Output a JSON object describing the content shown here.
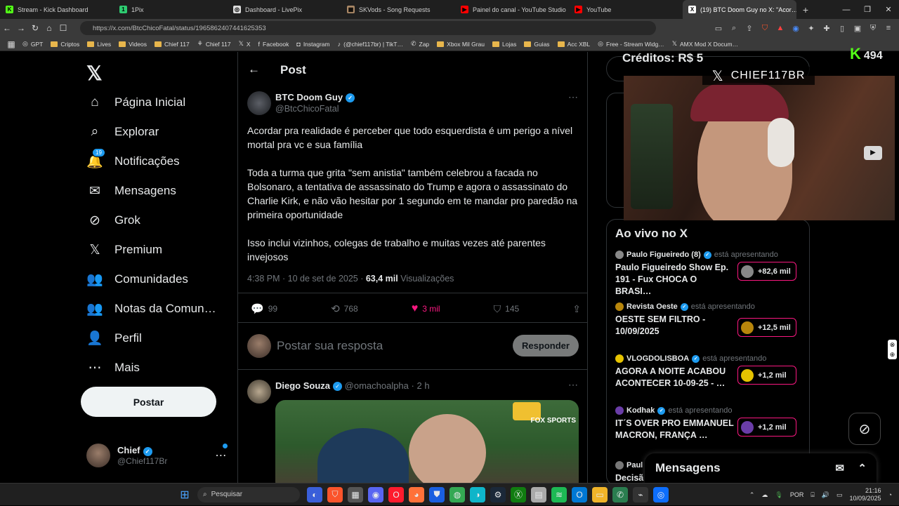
{
  "browser": {
    "tabs": [
      {
        "title": "Stream - Kick Dashboard",
        "color": "#53fc18",
        "glyph": "K"
      },
      {
        "title": "1Pix",
        "color": "#2ecc71",
        "glyph": "1"
      },
      {
        "title": "Dashboard - LivePix",
        "color": "#dddddd",
        "glyph": "◎"
      },
      {
        "title": "SKVods - Song Requests",
        "color": "#aa8866",
        "glyph": "▦"
      },
      {
        "title": "Painel do canal - YouTube Studio",
        "color": "#ff0000",
        "glyph": "▶"
      },
      {
        "title": "YouTube",
        "color": "#ff0000",
        "glyph": "▶"
      },
      {
        "title": "(19) BTC Doom Guy no X: \"Acor…",
        "color": "#ffffff",
        "glyph": "X",
        "active": true
      }
    ],
    "url": "https://x.com/BtcChicoFatal/status/1965862407441625353",
    "bookmarks": [
      {
        "label": "GPT",
        "icon": "◎"
      },
      {
        "label": "Criptos",
        "icon": "folder"
      },
      {
        "label": "Lives",
        "icon": "folder"
      },
      {
        "label": "Videos",
        "icon": "folder"
      },
      {
        "label": "Chief 117",
        "icon": "folder"
      },
      {
        "label": "Chief 117",
        "icon": "⚘"
      },
      {
        "label": "X",
        "icon": "𝕏"
      },
      {
        "label": "Facebook",
        "icon": "f"
      },
      {
        "label": "Instagram",
        "icon": "◘"
      },
      {
        "label": "(@chief117br) | TikT…",
        "icon": "♪"
      },
      {
        "label": "Zap",
        "icon": "✆"
      },
      {
        "label": "Xbox Mil Grau",
        "icon": "folder"
      },
      {
        "label": "Lojas",
        "icon": "folder"
      },
      {
        "label": "Guias",
        "icon": "folder"
      },
      {
        "label": "Acc XBL",
        "icon": "folder"
      },
      {
        "label": "Free - Stream Widg…",
        "icon": "◎"
      },
      {
        "label": "AMX Mod X Docum…",
        "icon": "𝕏"
      }
    ]
  },
  "sidebar": {
    "items": [
      {
        "label": "Página Inicial",
        "icon": "⌂"
      },
      {
        "label": "Explorar",
        "icon": "⌕"
      },
      {
        "label": "Notificações",
        "icon": "🔔",
        "badge": "19"
      },
      {
        "label": "Mensagens",
        "icon": "✉"
      },
      {
        "label": "Grok",
        "icon": "⊘"
      },
      {
        "label": "Premium",
        "icon": "𝕏"
      },
      {
        "label": "Comunidades",
        "icon": "👥"
      },
      {
        "label": "Notas da Comun…",
        "icon": "👥"
      },
      {
        "label": "Perfil",
        "icon": "👤"
      },
      {
        "label": "Mais",
        "icon": "⋯"
      }
    ],
    "post_button": "Postar",
    "user": {
      "name": "Chief",
      "handle": "@Chief117Br"
    }
  },
  "post": {
    "header": "Post",
    "author": {
      "name": "BTC Doom Guy",
      "handle": "@BtcChicoFatal"
    },
    "paragraphs": [
      "Acordar pra realidade é perceber que todo esquerdista é um perigo a nível mortal pra vc e sua família",
      "Toda a turma que grita \"sem anistia\" também celebrou a facada no Bolsonaro, a tentativa de assassinato do Trump e agora o assassinato do Charlie Kirk, e não vão hesitar por 1 segundo em te mandar pro paredão na primeira oportunidade",
      "Isso inclui vizinhos, colegas de trabalho e muitas vezes até parentes invejosos"
    ],
    "timestamp": "4:38 PM · 10 de set de 2025 · ",
    "views_count": "63,4 mil",
    "views_label": " Visualizações",
    "stats": {
      "replies": "99",
      "reposts": "768",
      "likes": "3 mil",
      "bookmarks": "145"
    },
    "reply_placeholder": "Postar sua resposta",
    "reply_button": "Responder"
  },
  "reply": {
    "author": {
      "name": "Diego Souza",
      "handle": "@omachoalpha",
      "time": "· 2 h"
    },
    "video_watermark": "FOX SPORTS"
  },
  "right": {
    "live_header": "Ao vivo no X",
    "live_status": "está apresentando",
    "items": [
      {
        "host": "Paulo Figueiredo (8)",
        "title": "Paulo Figueiredo Show  Ep. 191 - Fux CHOCA O BRASI…",
        "count": "+82,6 mil",
        "color": "#888888"
      },
      {
        "host": "Revista Oeste",
        "title": "OESTE SEM FILTRO - 10/09/2025",
        "count": "+12,5 mil",
        "color": "#b8860b"
      },
      {
        "host": "VLOGDOLISBOA",
        "title": "AGORA A NOITE  ACABOU ACONTECER 10-09-25 - …",
        "count": "+1,2 mil",
        "color": "#e6c300"
      },
      {
        "host": "Kodhak",
        "title": "IT´S OVER PRO EMMANUEL MACRON, FRANÇA …",
        "count": "+1,2 mil",
        "color": "#6a3da8"
      }
    ],
    "last_host": "Paul",
    "last_title": "Decisã",
    "messages_label": "Mensagens"
  },
  "overlay": {
    "credits": "Créditos: R$ 5",
    "kick_count": "494",
    "channel": "CHIEF117BR"
  },
  "taskbar": {
    "search_placeholder": "Pesquisar",
    "lang": "POR",
    "time": "21:16",
    "date": "10/09/2025"
  }
}
